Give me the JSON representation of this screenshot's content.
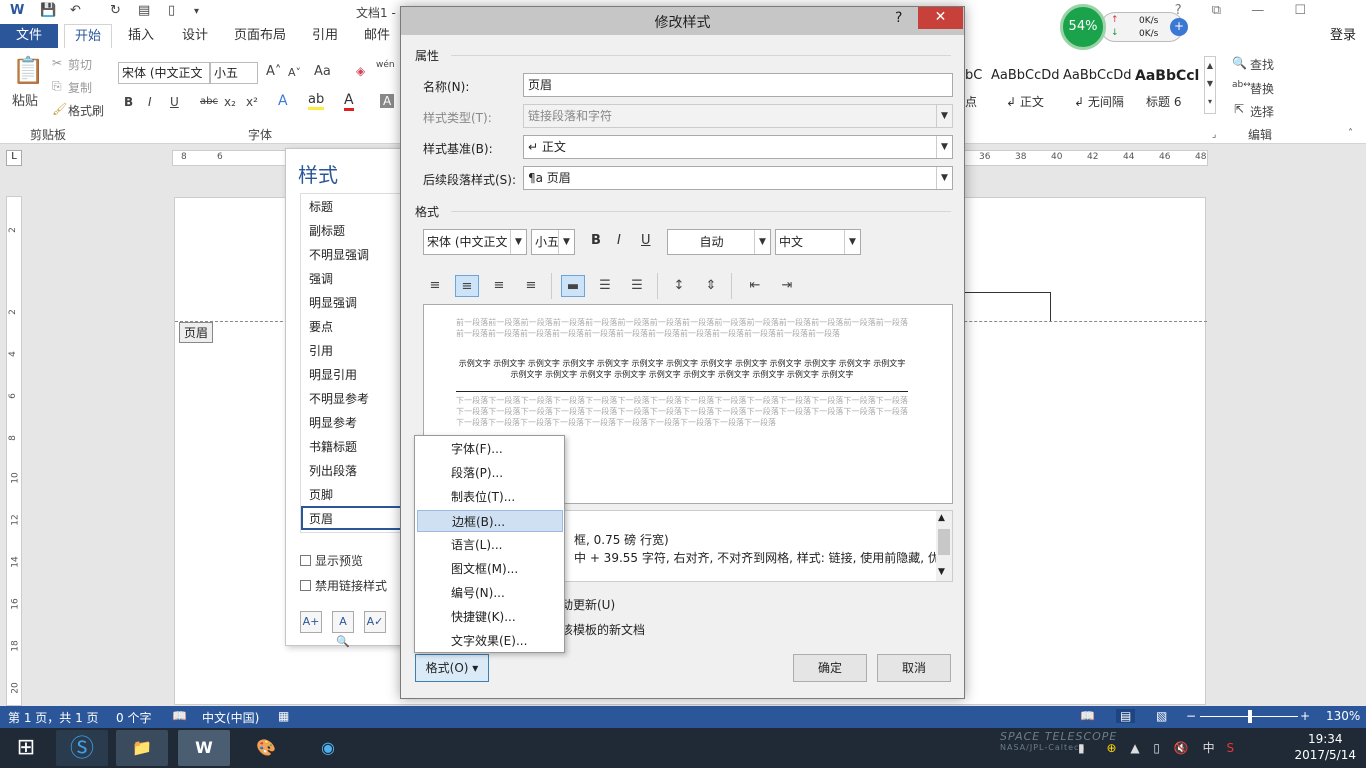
{
  "window": {
    "doc_title": "文档1 -",
    "login": "登录",
    "quick_access": [
      "W",
      "💾",
      "↶",
      "↻",
      "▤",
      "▯",
      "▾"
    ],
    "controls": [
      "?",
      "⧉",
      "—",
      "☐",
      "✕"
    ]
  },
  "ribbon": {
    "tabs": [
      "文件",
      "开始",
      "插入",
      "设计",
      "页面布局",
      "引用",
      "邮件"
    ],
    "clipboard": {
      "paste": "粘贴",
      "cut": "剪切",
      "copy": "复制",
      "format_painter": "格式刷",
      "group": "剪贴板"
    },
    "font": {
      "name": "宋体 (中文正文",
      "size": "小五",
      "group": "字体",
      "case": "Aa",
      "pinyin": "wén",
      "bold": "B",
      "italic": "I",
      "underline": "U",
      "strike": "abc",
      "sub": "x₂",
      "sup": "x²"
    },
    "styles": [
      {
        "preview": "bC",
        "name": "点"
      },
      {
        "preview": "AaBbCcDd",
        "name": "↲ 正文"
      },
      {
        "preview": "AaBbCcDd",
        "name": "↲ 无间隔"
      },
      {
        "preview": "AaBbCcl",
        "name": "标题 6"
      }
    ],
    "editing": {
      "find": "查找",
      "replace": "替换",
      "select": "选择",
      "group": "编辑"
    }
  },
  "ruler": [
    "8",
    "6",
    "36",
    "38",
    "40",
    "42",
    "44",
    "46",
    "48"
  ],
  "vruler": [
    "2",
    "2",
    "4",
    "6",
    "8",
    "10",
    "12",
    "14",
    "16",
    "18",
    "20"
  ],
  "page": {
    "header_tag": "页眉"
  },
  "styles_pane": {
    "title": "样式",
    "items": [
      "标题",
      "副标题",
      "不明显强调",
      "强调",
      "明显强调",
      "要点",
      "引用",
      "明显引用",
      "不明显参考",
      "明显参考",
      "书籍标题",
      "列出段落",
      "页脚",
      "页眉"
    ],
    "show_preview": "显示预览",
    "disable_linked": "禁用链接样式"
  },
  "dialog": {
    "title": "修改样式",
    "help": "?",
    "close": "✕",
    "section_properties": "属性",
    "name_label": "名称(N):",
    "name_value": "页眉",
    "type_label": "样式类型(T):",
    "type_value": "链接段落和字符",
    "based_label": "样式基准(B):",
    "based_value": "↵ 正文",
    "next_label": "后续段落样式(S):",
    "next_value": "¶a 页眉",
    "section_format": "格式",
    "font": "宋体 (中文正文",
    "size": "小五",
    "bold": "B",
    "italic": "I",
    "underline": "U",
    "color": "自动",
    "script": "中文",
    "preview_prev": "前一段落前一段落前一段落前一段落前一段落前一段落前一段落前一段落前一段落前一段落前一段落前一段落前一段落前一段落前一段落前一段落前一段落前一段落前一段落前一段落前一段落前一段落前一段落前一段落前一段落前一段落",
    "preview_sample": "示例文字 示例文字 示例文字 示例文字 示例文字 示例文字 示例文字 示例文字 示例文字 示例文字 示例文字 示例文字 示例文字 示例文字 示例文字 示例文字 示例文字 示例文字 示例文字 示例文字 示例文字 示例文字 示例文字",
    "preview_next": "下一段落下一段落下一段落下一段落下一段落下一段落下一段落下一段落下一段落下一段落下一段落下一段落下一段落下一段落下一段落下一段落下一段落下一段落下一段落下一段落下一段落下一段落下一段落下一段落下一段落下一段落下一段落下一段落下一段落下一段落下一段落下一段落下一段落下一段落下一段落下一段落下一段落下一段落",
    "desc_line1": "框, 0.75 磅 行宽)",
    "desc_line2": "中 + 39.55 字符, 右对齐, 不对齐到网格, 样式: 链接, 使用前隐藏, 优",
    "auto_update": "动更新(U)",
    "template": "该模板的新文档",
    "ok": "确定",
    "cancel": "取消",
    "format_button": "格式(O) ▾"
  },
  "format_menu": [
    "字体(F)...",
    "段落(P)...",
    "制表位(T)...",
    "边框(B)...",
    "语言(L)...",
    "图文框(M)...",
    "编号(N)...",
    "快捷键(K)...",
    "文字效果(E)..."
  ],
  "netmeter": {
    "percent": "54%",
    "up": "0K/s",
    "down": "0K/s"
  },
  "statusbar": {
    "page": "第 1 页，共 1 页",
    "words": "0 个字",
    "lang": "中文(中国)",
    "zoom": "130%"
  },
  "taskbar": {
    "time": "19:34",
    "date": "2017/5/14",
    "ime": "中",
    "wallpaper_text": "SPACE TELESCOPE",
    "wallpaper_credit": "NASA/JPL-Caltech"
  }
}
